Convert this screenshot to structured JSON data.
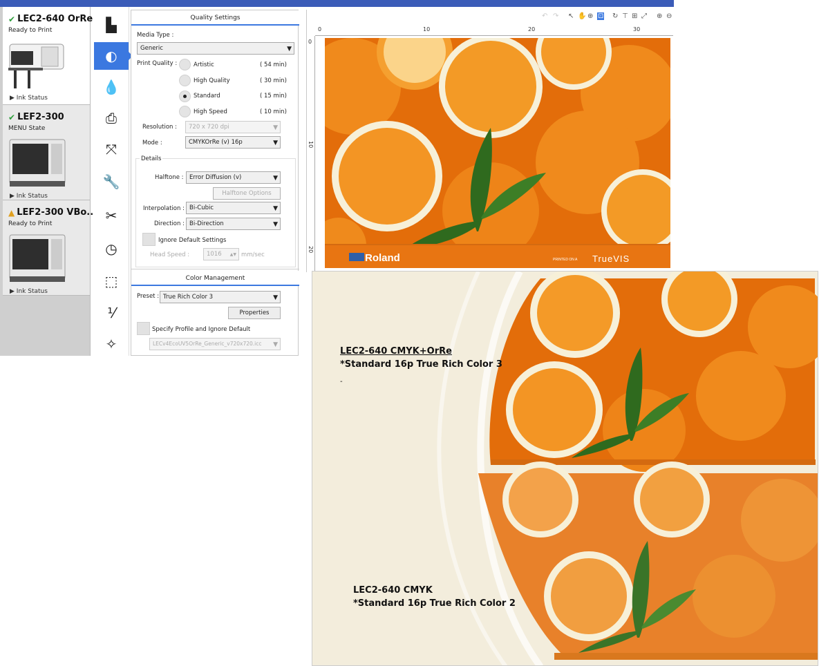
{
  "printers": [
    {
      "name": "LEC2-640 OrRe",
      "status_icon": "check",
      "state": "Ready to Print",
      "ink": "Ink Status"
    },
    {
      "name": "LEF2-300",
      "status_icon": "check",
      "state": "MENU State",
      "ink": "Ink Status"
    },
    {
      "name": "LEF2-300 VBo...",
      "status_icon": "warning",
      "state": "Ready to Print",
      "ink": "Ink Status"
    }
  ],
  "tools": [
    "layout-icon",
    "quality-icon",
    "ink-drops-icon",
    "print-job-icon",
    "fit-icon",
    "wrench-icon",
    "scissors-icon",
    "clock-icon",
    "crop-icon",
    "number-icon",
    "swatch-icon"
  ],
  "quality": {
    "header": "Quality Settings",
    "media_type_label": "Media Type :",
    "media_type": "Generic",
    "print_quality_label": "Print Quality :",
    "options": [
      {
        "label": "Artistic",
        "time": "( 54 min)",
        "selected": false
      },
      {
        "label": "High Quality",
        "time": "( 30 min)",
        "selected": false
      },
      {
        "label": "Standard",
        "time": "( 15 min)",
        "selected": true
      },
      {
        "label": "High Speed",
        "time": "( 10 min)",
        "selected": false
      }
    ],
    "resolution_label": "Resolution :",
    "resolution": "720 x 720 dpi",
    "mode_label": "Mode :",
    "mode": "CMYKOrRe (v) 16p",
    "details_label": "Details",
    "halftone_label": "Halftone :",
    "halftone": "Error Diffusion (v)",
    "halftone_options": "Halftone Options",
    "interpolation_label": "Interpolation :",
    "interpolation": "Bi-Cubic",
    "direction_label": "Direction :",
    "direction": "Bi-Direction",
    "ignore_default": "Ignore Default Settings",
    "head_speed_label": "Head Speed :",
    "head_speed": "1016",
    "head_speed_unit": "mm/sec"
  },
  "color": {
    "header": "Color Management",
    "preset_label": "Preset :",
    "preset": "True Rich Color 3",
    "properties": "Properties",
    "specify_profile": "Specify Profile and Ignore Default",
    "profile": "LECv4EcoUV5OrRe_Generic_v720x720.icc"
  },
  "preview": {
    "ruler_h": [
      "0",
      "10",
      "20",
      "30"
    ],
    "ruler_v": [
      "0",
      "10",
      "20"
    ],
    "brand": "Roland",
    "printed_on": "PRINTED ON A",
    "truevis": "TrueVIS"
  },
  "comparison": {
    "top_line1": "LEC2-640 CMYK+OrRe",
    "top_line2": "*Standard 16p True Rich Color 3",
    "top_dash": "-",
    "bottom_line1": "LEC2-640 CMYK",
    "bottom_line2": "*Standard 16p True Rich Color 2"
  },
  "colors": {
    "accent": "#3b78e0",
    "orange": "#f07a10",
    "topbar": "#3b5cb8"
  }
}
